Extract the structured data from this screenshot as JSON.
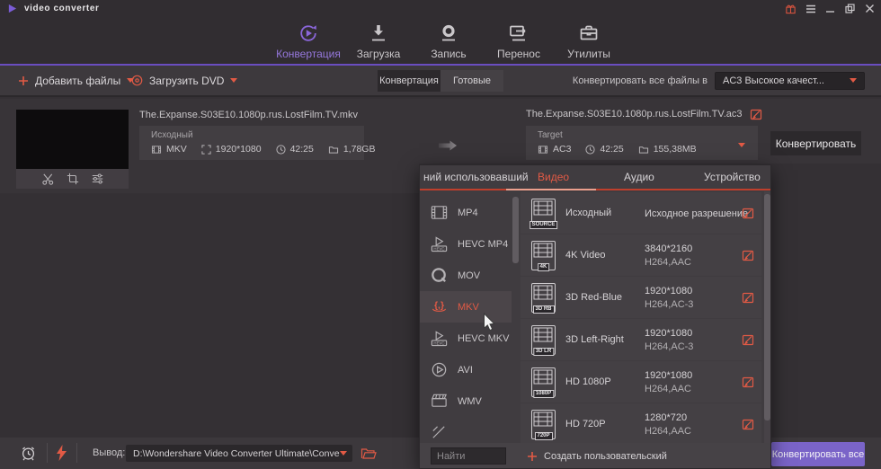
{
  "titlebar": {
    "app_title": "video converter"
  },
  "nav": {
    "tabs": [
      {
        "label": "Конвертация"
      },
      {
        "label": "Загрузка"
      },
      {
        "label": "Запись"
      },
      {
        "label": "Перенос"
      },
      {
        "label": "Утилиты"
      }
    ]
  },
  "toolbar": {
    "add_files_label": "Добавить файлы",
    "load_dvd_label": "Загрузить DVD",
    "view_tabs": {
      "convert": "Конвертация",
      "finished": "Готовые"
    },
    "convert_all_to_label": "Конвертировать все файлы в",
    "convert_all_to_value": "AC3 Высокое качест..."
  },
  "file": {
    "source_filename": "The.Expanse.S03E10.1080p.rus.LostFilm.TV.mkv",
    "source_panel": {
      "title": "Исходный",
      "format": "MKV",
      "resolution": "1920*1080",
      "duration": "42:25",
      "size": "1,78GB"
    },
    "target_filename": "The.Expanse.S03E10.1080p.rus.LostFilm.TV.ac3",
    "target_panel": {
      "title": "Target",
      "format": "AC3",
      "duration": "42:25",
      "size": "155,38MB"
    },
    "convert_button_label": "Конвертировать"
  },
  "format_popup": {
    "tabs": {
      "recent": "ний использовавший",
      "video": "Видео",
      "audio": "Аудио",
      "device": "Устройство"
    },
    "formats": [
      {
        "label": "MP4"
      },
      {
        "label": "HEVC MP4"
      },
      {
        "label": "MOV"
      },
      {
        "label": "MKV"
      },
      {
        "label": "HEVC MKV"
      },
      {
        "label": "AVI"
      },
      {
        "label": "WMV"
      },
      {
        "label": ""
      }
    ],
    "selected_format": "MKV",
    "presets": [
      {
        "name": "Исходный",
        "badge": "SOURCE",
        "resolution": "Исходное разрешение",
        "codec": ""
      },
      {
        "name": "4K Video",
        "badge": "4K",
        "resolution": "3840*2160",
        "codec": "H264,AAC"
      },
      {
        "name": "3D Red-Blue",
        "badge": "3D RB",
        "resolution": "1920*1080",
        "codec": "H264,AC-3"
      },
      {
        "name": "3D Left-Right",
        "badge": "3D LR",
        "resolution": "1920*1080",
        "codec": "H264,AC-3"
      },
      {
        "name": "HD 1080P",
        "badge": "1080P",
        "resolution": "1920*1080",
        "codec": "H264,AAC"
      },
      {
        "name": "HD 720P",
        "badge": "720P",
        "resolution": "1280*720",
        "codec": "H264,AAC"
      }
    ],
    "search_placeholder": "Найти",
    "create_custom_label": "Создать пользовательский"
  },
  "bottombar": {
    "output_label": "Вывод:",
    "output_path": "D:\\Wondershare Video Converter Ultimate\\Converted",
    "convert_all_button_label": "Конвертировать все"
  },
  "colors": {
    "accent_red": "#e25a45",
    "accent_purple": "#8a66d9",
    "button_purple": "#7a64c8"
  }
}
